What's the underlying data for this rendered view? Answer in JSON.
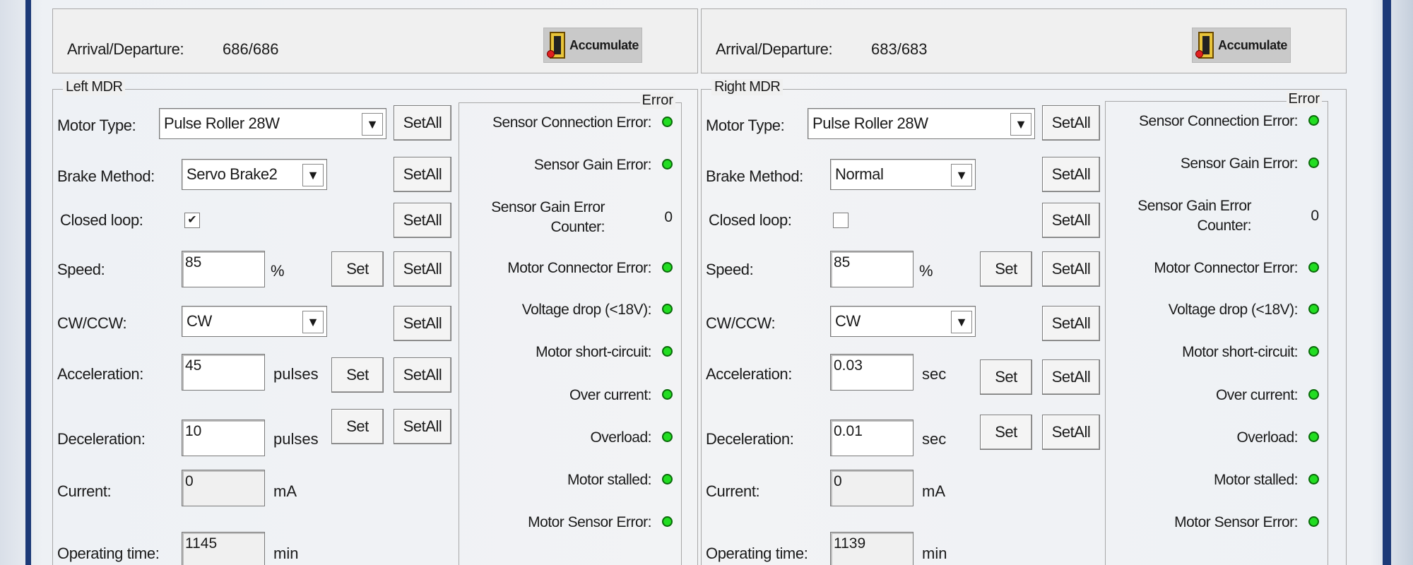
{
  "left": {
    "arrival_label": "Arrival/Departure:",
    "arrival_value": "686/686",
    "accumulate_label": "Accumulate",
    "group_title": "Left MDR",
    "motor_type_label": "Motor Type:",
    "motor_type_value": "Pulse Roller 28W",
    "brake_label": "Brake Method:",
    "brake_value": "Servo Brake2",
    "closed_loop_label": "Closed loop:",
    "closed_loop_checked": "✔",
    "speed_label": "Speed:",
    "speed_value": "85",
    "speed_unit": "%",
    "cw_label": "CW/CCW:",
    "cw_value": "CW",
    "accel_label": "Acceleration:",
    "accel_value": "45",
    "accel_unit": "pulses",
    "decel_label": "Deceleration:",
    "decel_value": "10",
    "decel_unit": "pulses",
    "current_label": "Current:",
    "current_value": "0",
    "current_unit": "mA",
    "op_label": "Operating time:",
    "op_value": "1145",
    "op_unit": "min",
    "set_label": "Set",
    "setall_label": "SetAll",
    "error": {
      "title": "Error",
      "sensor_conn": "Sensor Connection Error:",
      "sensor_gain": "Sensor Gain Error:",
      "gain_counter_l1": "Sensor Gain Error",
      "gain_counter_l2": "Counter:",
      "gain_counter_value": "0",
      "motor_conn": "Motor Connector Error:",
      "voltage": "Voltage drop (<18V):",
      "short": "Motor short-circuit:",
      "over_current": "Over current:",
      "overload": "Overload:",
      "stalled": "Motor stalled:",
      "motor_sensor": "Motor Sensor Error:"
    }
  },
  "right": {
    "arrival_label": "Arrival/Departure:",
    "arrival_value": "683/683",
    "accumulate_label": "Accumulate",
    "group_title": "Right MDR",
    "motor_type_label": "Motor Type:",
    "motor_type_value": "Pulse Roller 28W",
    "brake_label": "Brake Method:",
    "brake_value": "Normal",
    "closed_loop_label": "Closed loop:",
    "closed_loop_checked": "",
    "speed_label": "Speed:",
    "speed_value": "85",
    "speed_unit": "%",
    "cw_label": "CW/CCW:",
    "cw_value": "CW",
    "accel_label": "Acceleration:",
    "accel_value": "0.03",
    "accel_unit": "sec",
    "decel_label": "Deceleration:",
    "decel_value": "0.01",
    "decel_unit": "sec",
    "current_label": "Current:",
    "current_value": "0",
    "current_unit": "mA",
    "op_label": "Operating time:",
    "op_value": "1139",
    "op_unit": "min",
    "set_label": "Set",
    "setall_label": "SetAll",
    "error": {
      "title": "Error",
      "sensor_conn": "Sensor Connection Error:",
      "sensor_gain": "Sensor Gain Error:",
      "gain_counter_l1": "Sensor Gain Error",
      "gain_counter_l2": "Counter:",
      "gain_counter_value": "0",
      "motor_conn": "Motor Connector Error:",
      "voltage": "Voltage drop (<18V):",
      "short": "Motor short-circuit:",
      "over_current": "Over current:",
      "overload": "Overload:",
      "stalled": "Motor stalled:",
      "motor_sensor": "Motor Sensor Error:"
    }
  },
  "colors": {
    "led_ok": "#22dd22",
    "window_frame": "#1d3a78"
  }
}
